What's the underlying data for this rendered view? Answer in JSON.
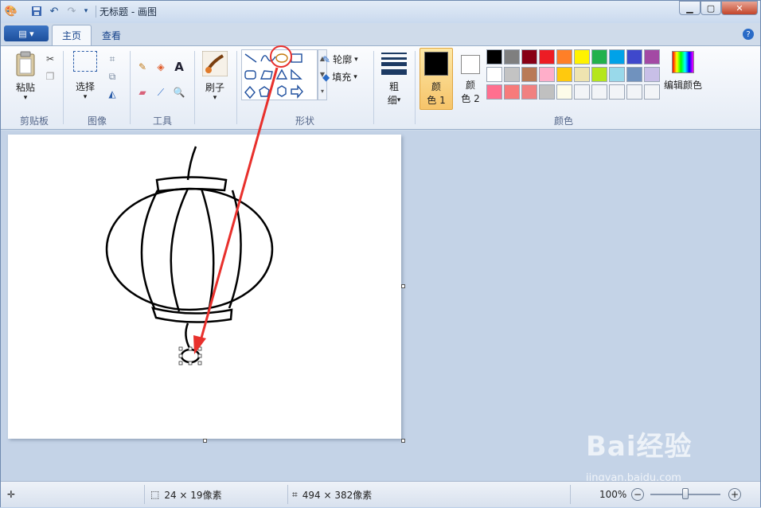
{
  "window": {
    "title": "无标题 - 画图"
  },
  "tabs": [
    "主页",
    "查看"
  ],
  "ribbon": {
    "clipboard": {
      "paste_label": "粘贴",
      "group_label": "剪贴板"
    },
    "image": {
      "select_label": "选择",
      "group_label": "图像"
    },
    "tools": {
      "group_label": "工具"
    },
    "brushes": {
      "label": "刷子"
    },
    "shapes": {
      "outline_label": "轮廓",
      "fill_label": "填充",
      "group_label": "形状"
    },
    "size": {
      "label_line1": "粗",
      "label_line2": "细"
    },
    "colors": {
      "color1_line1": "颜",
      "color1_line2": "色 1",
      "color2_line1": "颜",
      "color2_line2": "色 2",
      "edit_label": "编辑颜色",
      "group_label": "颜色",
      "color1": "#000000",
      "color2": "#ffffff",
      "palette": [
        "#000000",
        "#7f7f7f",
        "#880015",
        "#ed1c24",
        "#ff7f27",
        "#fff200",
        "#22b14c",
        "#00a2e8",
        "#3f48cc",
        "#a349a4",
        "#ffffff",
        "#c3c3c3",
        "#b97a57",
        "#ffaec9",
        "#ffc90e",
        "#efe4b0",
        "#b5e61d",
        "#99d9ea",
        "#7092be",
        "#c8bfe7",
        "#ff6f8f",
        "#f77b7b",
        "#f08080",
        "#c0c0c0",
        "#fdfbe9",
        "#f2f4f7",
        "#f2f4f7",
        "#f2f4f7",
        "#f2f4f7",
        "#f2f4f7"
      ]
    }
  },
  "status": {
    "selection_size": "24 × 19像素",
    "canvas_size": "494 × 382像素",
    "zoom": "100%"
  },
  "watermark": {
    "brand": "Bai经验",
    "url": "jingyan.baidu.com"
  }
}
